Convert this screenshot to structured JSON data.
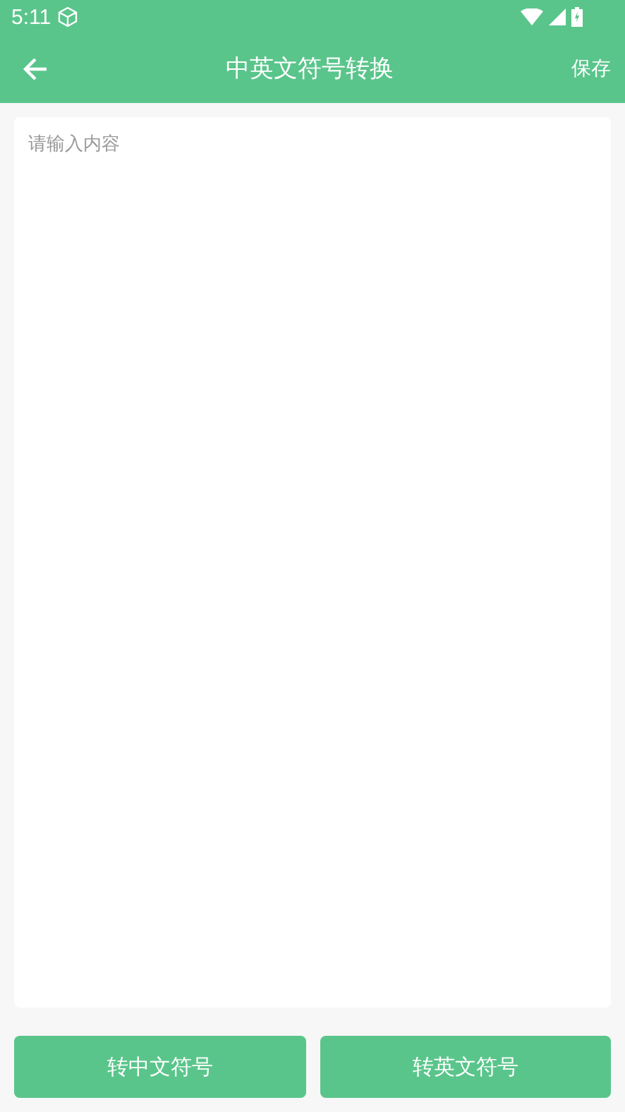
{
  "status_bar": {
    "time": "5:11"
  },
  "app_bar": {
    "title": "中英文符号转换",
    "action": "保存"
  },
  "input": {
    "placeholder": "请输入内容"
  },
  "buttons": [
    "转中文符号",
    "转英文符号"
  ]
}
